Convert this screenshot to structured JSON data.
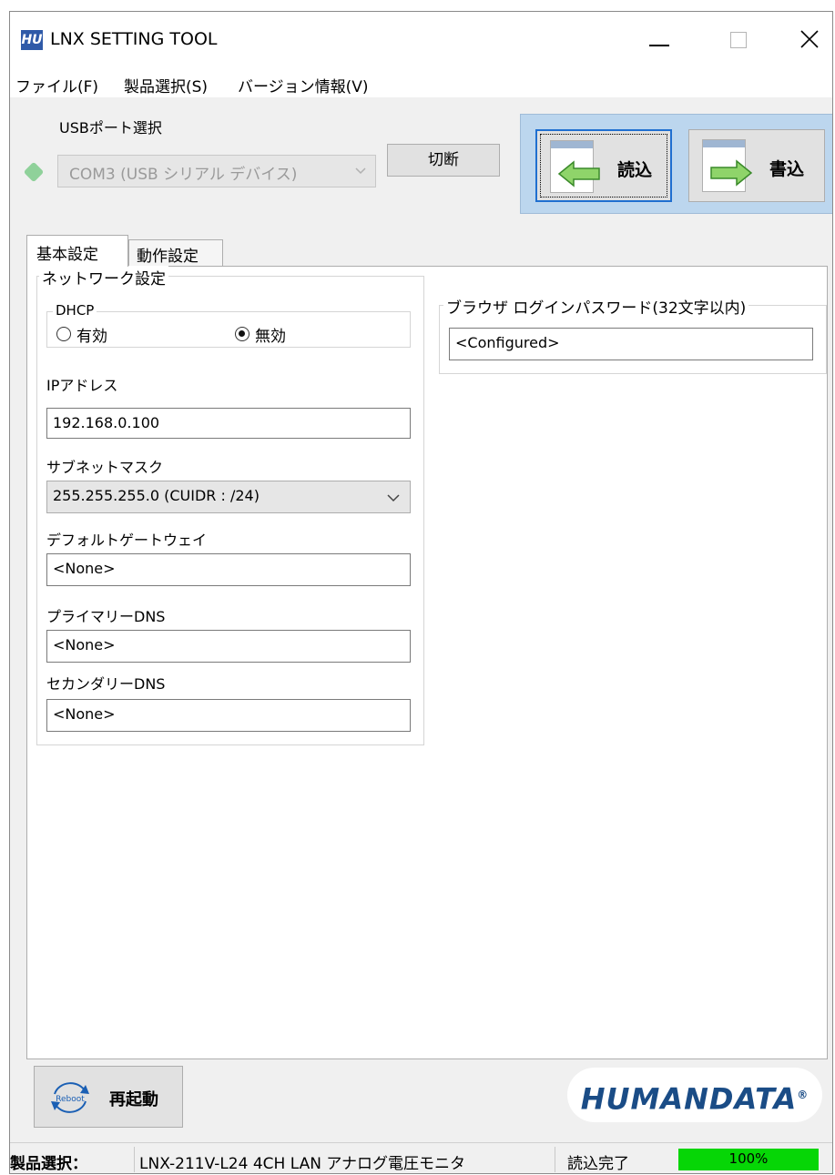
{
  "window": {
    "title": "LNX SETTING TOOL",
    "app_icon_text": "HU"
  },
  "menu": {
    "items": [
      "ファイル(F)",
      "製品選択(S)",
      "バージョン情報(V)"
    ]
  },
  "port": {
    "label": "USBポート選択",
    "selected": "COM3 (USB シリアル デバイス)",
    "disconnect_label": "切断"
  },
  "actions": {
    "read_label": "読込",
    "write_label": "書込"
  },
  "tabs": [
    {
      "label": "基本設定",
      "active": true
    },
    {
      "label": "動作設定",
      "active": false
    }
  ],
  "network": {
    "group_title": "ネットワーク設定",
    "dhcp": {
      "title": "DHCP",
      "enabled_label": "有効",
      "disabled_label": "無効",
      "selected": "無効"
    },
    "ip_label": "IPアドレス",
    "ip_value": "192.168.0.100",
    "subnet_label": "サブネットマスク",
    "subnet_value": "255.255.255.0 (CUIDR : /24)",
    "gateway_label": "デフォルトゲートウェイ",
    "gateway_value": "<None>",
    "dns1_label": "プライマリーDNS",
    "dns1_value": "<None>",
    "dns2_label": "セカンダリーDNS",
    "dns2_value": "<None>"
  },
  "password": {
    "group_title": "ブラウザ ログインパスワード(32文字以内)",
    "value": "<Configured>"
  },
  "reboot": {
    "label": "再起動",
    "icon_text": "Reboot"
  },
  "logo": {
    "text": "HUMANDATA",
    "mark": "®"
  },
  "statusbar": {
    "product_label": "製品選択：",
    "product_value": "LNX-211V-L24 4CH LAN アナログ電圧モニタ",
    "status_text": "読込完了",
    "progress_text": "100%",
    "progress": 1.0
  },
  "colors": {
    "accent": "#1f6fd0",
    "progress": "#06d606",
    "logo": "#1a4c86"
  }
}
